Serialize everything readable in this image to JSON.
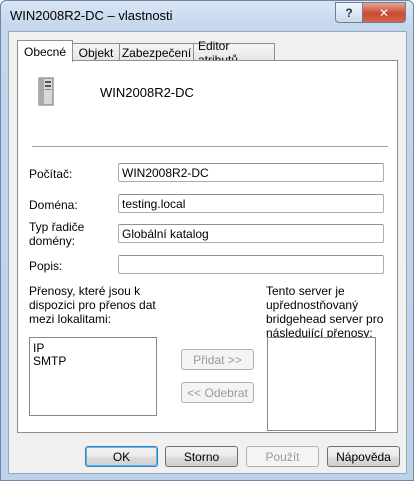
{
  "window": {
    "title": "WIN2008R2-DC – vlastnosti",
    "help_glyph": "?",
    "close_glyph": "✕"
  },
  "tabs": [
    {
      "label": "Obecné",
      "active": true
    },
    {
      "label": "Objekt",
      "active": false
    },
    {
      "label": "Zabezpečení",
      "active": false
    },
    {
      "label": "Editor atributů",
      "active": false
    }
  ],
  "general": {
    "server_name": "WIN2008R2-DC",
    "computer_label": "Počítač:",
    "computer_value": "WIN2008R2-DC",
    "domain_label": "Doména:",
    "domain_value": "testing.local",
    "dc_type_label_line1": "Typ řadiče",
    "dc_type_label_line2": "domény:",
    "dc_type_value": "Globální katalog",
    "description_label": "Popis:",
    "description_value": ""
  },
  "transports": {
    "available_label_line1": "Přenosy, které jsou k",
    "available_label_line2": "dispozici pro přenos dat",
    "available_label_line3": "mezi lokalitami:",
    "available_items": [
      "IP",
      "SMTP"
    ],
    "preferred_label_line1": "Tento server je",
    "preferred_label_line2": "upřednostňovaný",
    "preferred_label_line3": "bridgehead server pro",
    "preferred_label_line4": "následující přenosy:",
    "preferred_items": [],
    "add_button": "Přidat >>",
    "remove_button": "<< Odebrat"
  },
  "footer": {
    "ok": "OK",
    "cancel": "Storno",
    "apply": "Použít",
    "help": "Nápověda"
  },
  "colors": {
    "title_bar": "#c3d6ec",
    "close_button": "#c94a32"
  }
}
